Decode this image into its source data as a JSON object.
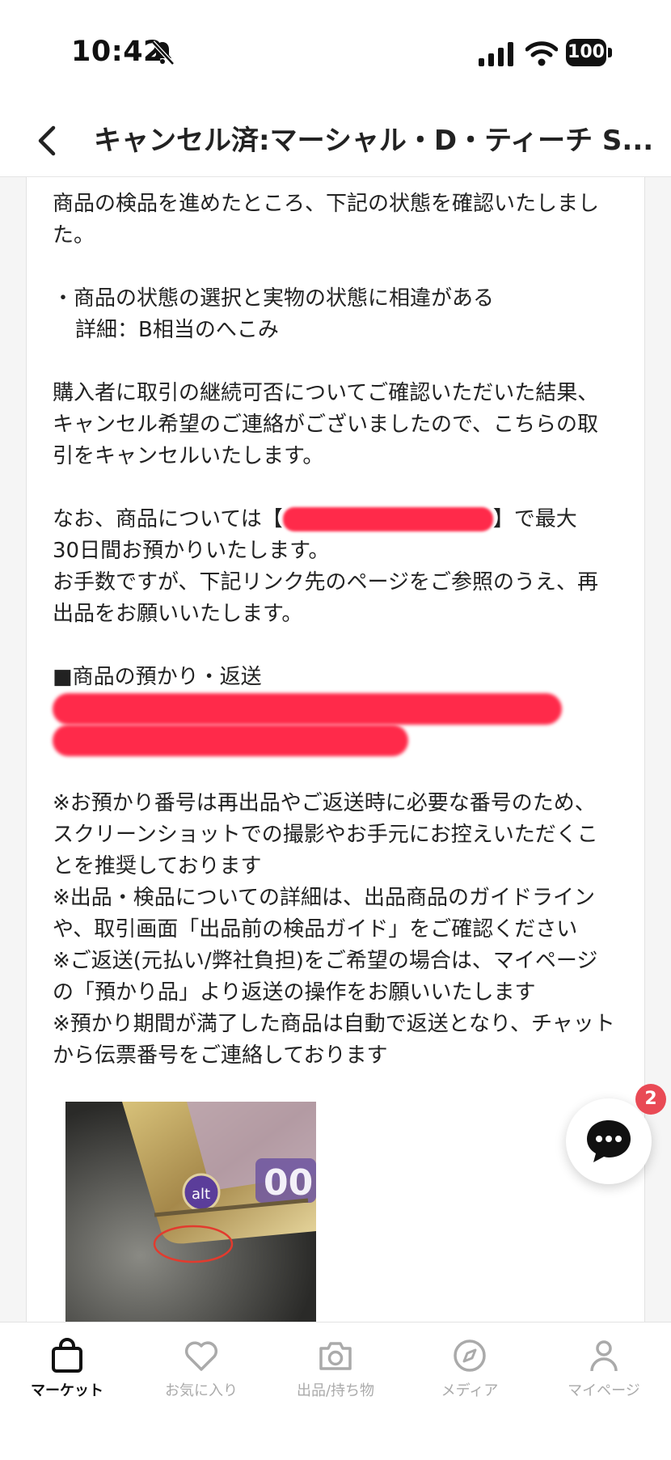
{
  "status_bar": {
    "time": "10:42",
    "battery": "100"
  },
  "header": {
    "title": "キャンセル済:マーシャル・D・ティーチ S..."
  },
  "message": {
    "p1": [
      "商品の検品を進めたところ、下記の状態を確認いたしまし",
      "た。"
    ],
    "p2": [
      "・商品の状態の選択と実物の状態に相違がある",
      "詳細：B相当のへこみ"
    ],
    "p3": [
      "購入者に取引の継続可否についてご確認いただいた結果、",
      "キャンセル希望のご連絡がございましたので、こちらの取",
      "引をキャンセルいたします。"
    ],
    "p4_prefix": "なお、商品については【",
    "p4_suffix": "】で最大",
    "p4_rest": [
      "30日間お預かりいたします。",
      "お手数ですが、下記リンク先のページをご参照のうえ、再",
      "出品をお願いいたします。"
    ],
    "p5_heading": "■商品の預かり・返送",
    "notes": [
      "※お預かり番号は再出品やご返送時に必要な番号のため、",
      "スクリーンショットでの撮影やお手元にお控えいただくこ",
      "とを推奨しております",
      "※出品・検品についての詳細は、出品商品のガイドライン",
      "や、取引画面「出品前の検品ガイド」をご確認ください",
      "※ご返送(元払い/弊社負担)をご希望の場合は、マイページ",
      "の「預かり品」より返送の操作をお願いいたします",
      "※預かり期間が満了した商品は自動で返送となり、チャット",
      "から伝票番号をご連絡しております"
    ]
  },
  "chat": {
    "badge_count": "2"
  },
  "bottom_nav": {
    "items": [
      {
        "label": "マーケット",
        "icon": "bag-icon",
        "active": true
      },
      {
        "label": "お気に入り",
        "icon": "heart-icon",
        "active": false
      },
      {
        "label": "出品/持ち物",
        "icon": "camera-icon",
        "active": false
      },
      {
        "label": "メディア",
        "icon": "compass-icon",
        "active": false
      },
      {
        "label": "マイページ",
        "icon": "person-icon",
        "active": false
      }
    ]
  },
  "colors": {
    "badge": "#e94a55",
    "redaction": "#ff2a4a",
    "active_nav": "#111111",
    "inactive_nav": "#aaaaaa"
  }
}
